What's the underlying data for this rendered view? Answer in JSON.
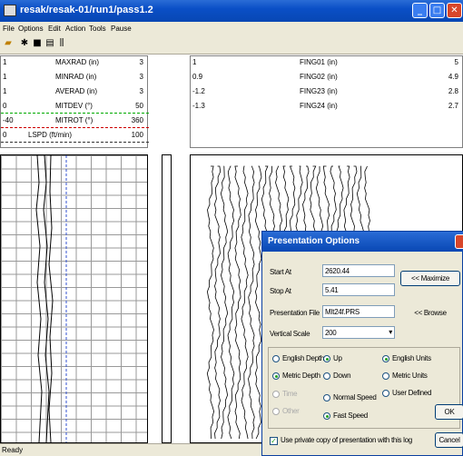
{
  "window": {
    "title": "resak/resak-01/run1/pass1.2"
  },
  "menu": [
    "File",
    "Options",
    "Edit",
    "Action",
    "Tools",
    "Pause"
  ],
  "toolbar_icons": [
    "open-icon",
    "logger-icon",
    "camera-icon",
    "print-icon",
    "signal-icon"
  ],
  "left_curves": [
    {
      "min": "1",
      "name": "MAXRAD (in)",
      "max": "3"
    },
    {
      "min": "1",
      "name": "MINRAD (in)",
      "max": "3"
    },
    {
      "min": "1",
      "name": "AVERAD (in)",
      "max": "3"
    },
    {
      "min": "0",
      "name": "MITDEV (°)",
      "max": "50"
    },
    {
      "min": "-40",
      "name": "MITROT (°)",
      "max": "360"
    },
    {
      "min": "0",
      "name": "LSPD (ft/min)",
      "max": "100"
    }
  ],
  "right_curves": [
    {
      "min": "1",
      "name": "FING01 (in)",
      "max": "5"
    },
    {
      "min": "0.9",
      "name": "FING02 (in)",
      "max": "4.9"
    },
    {
      "min": "-1.2",
      "name": "FING23 (in)",
      "max": "2.8"
    },
    {
      "min": "-1.3",
      "name": "FING24 (in)",
      "max": "2.7"
    }
  ],
  "status": {
    "text": "Ready"
  },
  "dialog": {
    "title": "Presentation Options",
    "start_label": "Start At",
    "start_value": "2620.44",
    "stop_label": "Stop At",
    "stop_value": "5.41",
    "file_label": "Presentation File",
    "file_value": "MIt24f.PRS",
    "scale_label": "Vertical Scale",
    "scale_value": "200",
    "maximize_label": "<< Maximize",
    "browse_label": "<< Browse",
    "depth_options": [
      {
        "label": "English Depth",
        "selected": false,
        "disabled": false
      },
      {
        "label": "Metric Depth",
        "selected": true,
        "disabled": false
      },
      {
        "label": "Time",
        "selected": false,
        "disabled": true
      },
      {
        "label": "Other",
        "selected": false,
        "disabled": true
      }
    ],
    "direction_options": [
      {
        "label": "Up",
        "selected": true
      },
      {
        "label": "Down",
        "selected": false
      }
    ],
    "speed_options": [
      {
        "label": "Normal Speed",
        "selected": false
      },
      {
        "label": "Fast Speed",
        "selected": true
      }
    ],
    "unit_options": [
      {
        "label": "English Units",
        "selected": true
      },
      {
        "label": "Metric Units",
        "selected": false
      },
      {
        "label": "User Defined",
        "selected": false
      }
    ],
    "ok_label": "OK",
    "cancel_label": "Cancel",
    "private_copy_label": "Use private copy of presentation with this log",
    "private_copy_checked": true
  }
}
